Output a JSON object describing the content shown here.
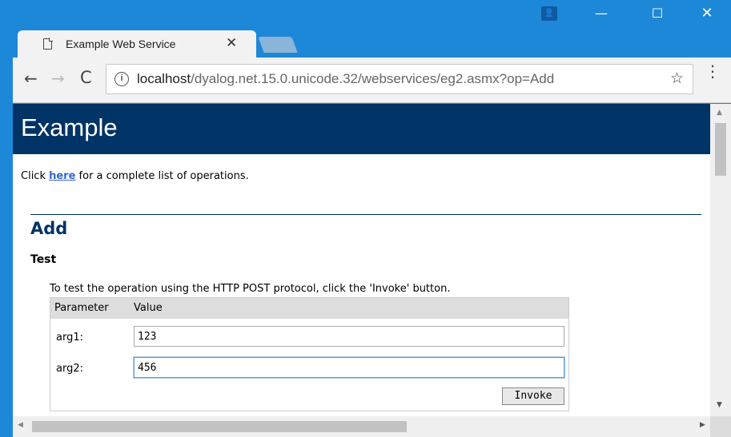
{
  "tab": {
    "title": "Example Web Service",
    "close_glyph": "✕"
  },
  "window_controls": {
    "user_glyph": "👤",
    "minimize": "—",
    "maximize": "☐",
    "close": "✕"
  },
  "toolbar": {
    "back": "←",
    "forward": "→",
    "reload": "C",
    "info_glyph": "i",
    "url_host": "localhost",
    "url_path": "/dyalog.net.15.0.unicode.32/webservices/eg2.asmx?op=Add",
    "star": "☆",
    "menu": "⋮"
  },
  "page": {
    "header": "Example",
    "intro_before": "Click ",
    "intro_link": "here",
    "intro_after": " for a complete list of operations.",
    "operation": "Add",
    "section": "Test",
    "instructions": "To test the operation using the HTTP POST protocol, click the 'Invoke' button.",
    "table": {
      "col_param": "Parameter",
      "col_value": "Value",
      "rows": [
        {
          "label": "arg1:",
          "value": "123"
        },
        {
          "label": "arg2:",
          "value": "456"
        }
      ],
      "invoke_label": "Invoke"
    }
  },
  "scroll": {
    "up": "▲",
    "down": "▼",
    "left": "◀",
    "right": "▶"
  },
  "colors": {
    "chrome_blue": "#1e88d8",
    "header_navy": "#003366",
    "link_blue": "#3366cc"
  }
}
